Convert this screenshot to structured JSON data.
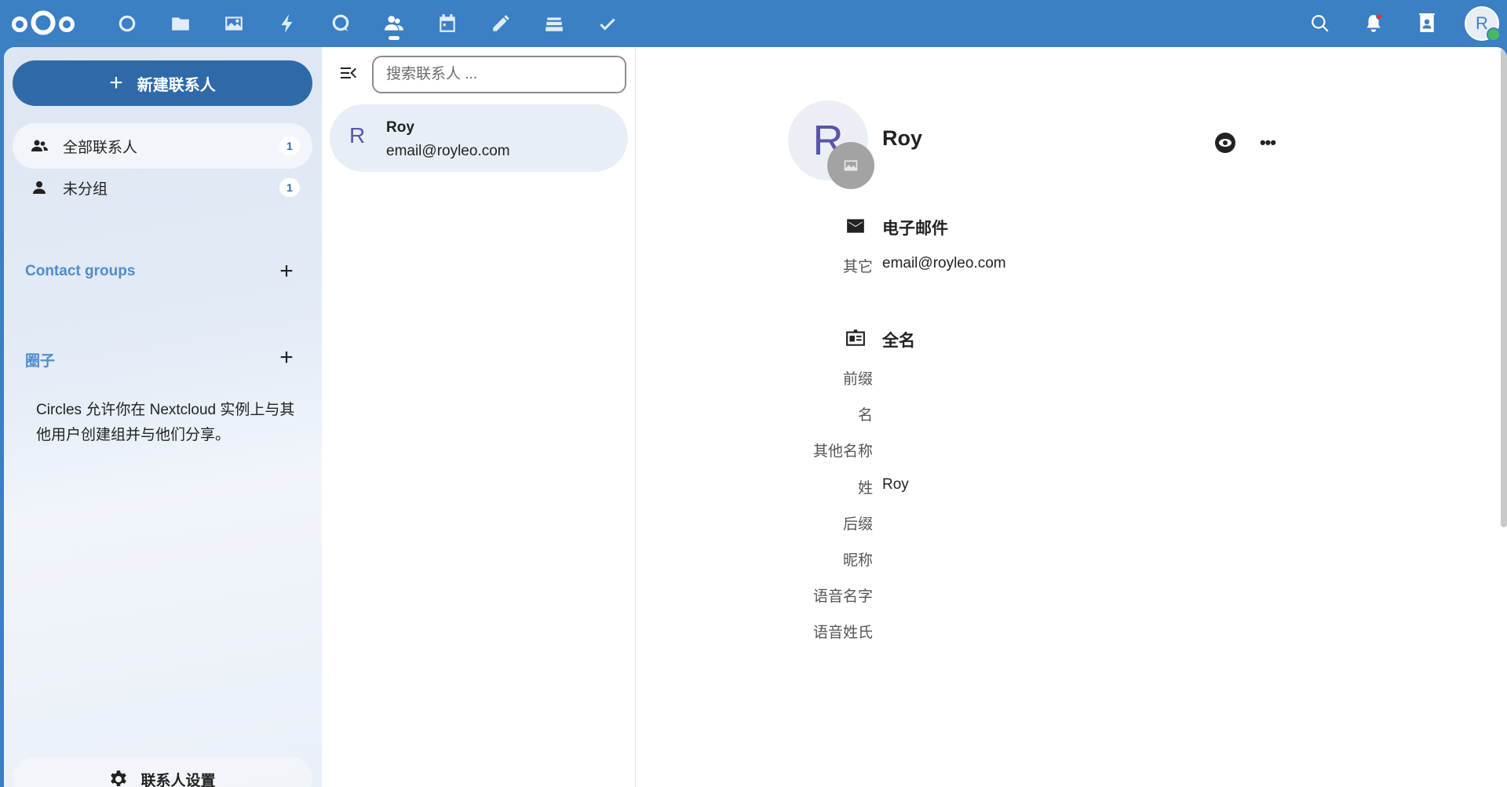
{
  "topbar": {
    "logo_icon": "nextcloud-logo",
    "apps": [
      {
        "name": "dashboard",
        "icon": "dashboard-icon"
      },
      {
        "name": "files",
        "icon": "folder-icon"
      },
      {
        "name": "photos",
        "icon": "image-icon"
      },
      {
        "name": "activity",
        "icon": "lightning-icon"
      },
      {
        "name": "talk",
        "icon": "talk-icon"
      },
      {
        "name": "contacts",
        "icon": "contacts-icon",
        "active": true
      },
      {
        "name": "calendar",
        "icon": "calendar-icon"
      },
      {
        "name": "notes",
        "icon": "pencil-icon"
      },
      {
        "name": "deck",
        "icon": "deck-icon"
      },
      {
        "name": "tasks",
        "icon": "checkmark-icon"
      }
    ],
    "right_icons": [
      "search-icon",
      "bell-icon",
      "contacts-menu-icon"
    ],
    "user_initial": "R"
  },
  "sidebar": {
    "new_contact": "新建联系人",
    "items": [
      {
        "label": "全部联系人",
        "count": "1"
      },
      {
        "label": "未分组",
        "count": "1"
      }
    ],
    "contact_groups_caption": "Contact groups",
    "circles_caption": "圈子",
    "circles_text": "Circles 允许你在 Nextcloud 实例上与其他用户创建组并与他们分享。",
    "settings_label": "联系人设置"
  },
  "list": {
    "search_placeholder": "搜索联系人 ...",
    "contacts": [
      {
        "initial": "R",
        "name": "Roy",
        "email": "email@royleo.com"
      }
    ]
  },
  "detail": {
    "avatar_initial": "R",
    "name": "Roy",
    "email_section": "电子邮件",
    "email_label": "其它",
    "email_value": "email@royleo.com",
    "fullname_section": "全名",
    "fields": [
      {
        "label": "前缀",
        "value": ""
      },
      {
        "label": "名",
        "value": ""
      },
      {
        "label": "其他名称",
        "value": ""
      },
      {
        "label": "姓",
        "value": "Roy"
      },
      {
        "label": "后缀",
        "value": ""
      },
      {
        "label": "昵称",
        "value": ""
      },
      {
        "label": "语音名字",
        "value": ""
      },
      {
        "label": "语音姓氏",
        "value": ""
      }
    ]
  },
  "colors": {
    "header": "#3b7fc4",
    "primary_button": "#2f6aa8",
    "caption": "#4f8ccb",
    "avatar_text": "#5a55a8"
  }
}
